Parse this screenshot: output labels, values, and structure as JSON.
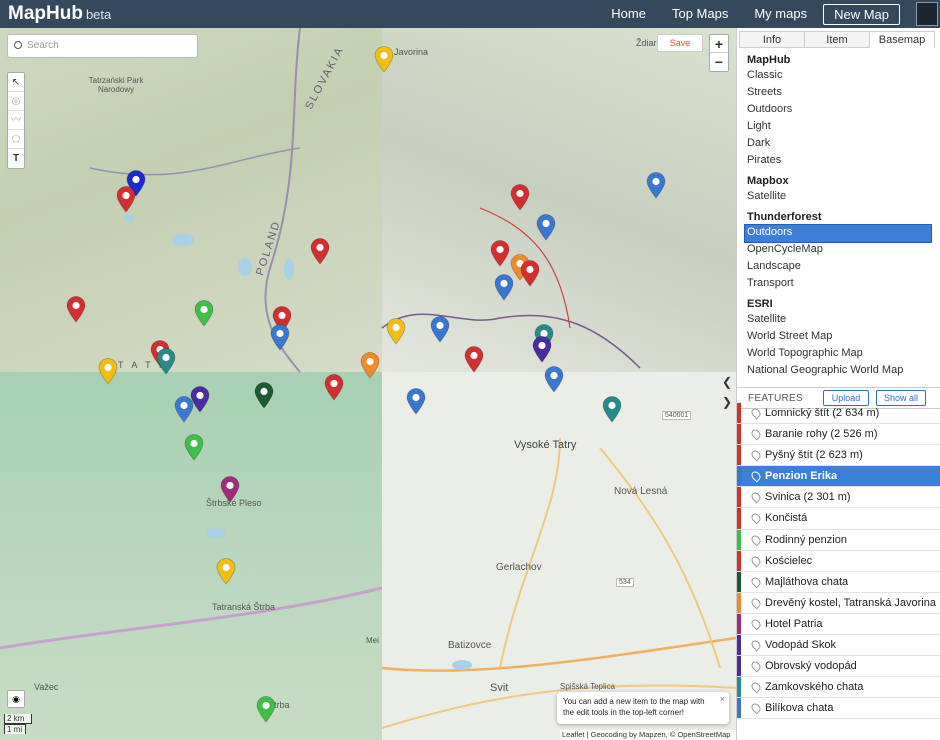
{
  "app": {
    "name": "MapHub",
    "tag": "beta"
  },
  "nav": {
    "home": "Home",
    "top_maps": "Top Maps",
    "my_maps": "My maps",
    "new_map": "New Map"
  },
  "map": {
    "search_placeholder": "Search",
    "save": "Save",
    "zoom_in": "+",
    "zoom_out": "−",
    "tools": [
      "↖",
      "◎",
      "〰",
      "⬠",
      "T"
    ],
    "scale_km": "2 km",
    "scale_mi": "1 mi",
    "tip": "You can add a new item to the map with the edit tools in the top-left corner!",
    "tip_close": "×",
    "attribution": "Leaflet | Geocoding by Mapzen, © OpenStreetMap",
    "labels": {
      "tatra_park": "Tatrzański Park Narodowy",
      "slovakia": "SLOVAKIA",
      "poland": "POLAND",
      "javorina": "Javorina",
      "zdiar": "Ždiar",
      "vysoke_tatry": "Vysoké Tatry",
      "nova_lesna": "Nová Lesná",
      "gerlachov": "Gerlachov",
      "batizovce": "Batizovce",
      "svit": "Svit",
      "strbske_pleso": "Štrbské Pleso",
      "tatranska_strba": "Tatranská Štrba",
      "vazec": "Važec",
      "spisska_teplica": "Spišská Teplica",
      "tatra": "T A T R",
      "road_540": "540001",
      "road_534": "534",
      "mei": "Mei",
      "strba": "Štrba"
    },
    "pin_colors": {
      "red": "#d32f2f",
      "blue": "#3a78d0",
      "navy": "#1a2ad0",
      "green": "#3fbf4a",
      "yellow": "#f2bd16",
      "orange": "#f08a2a",
      "teal": "#2a8a8a",
      "purple": "#4b2ca0",
      "darkgreen": "#1d5a33",
      "magenta": "#a12c7b"
    }
  },
  "panel": {
    "tabs": [
      "Info",
      "Item",
      "Basemap"
    ],
    "active_tab": "Basemap",
    "basemap_groups": [
      {
        "name": "MapHub",
        "items": [
          "Classic",
          "Streets",
          "Outdoors",
          "Light",
          "Dark",
          "Pirates"
        ]
      },
      {
        "name": "Mapbox",
        "items": [
          "Satellite"
        ]
      },
      {
        "name": "Thunderforest",
        "items": [
          "Outdoors",
          "OpenCycleMap",
          "Landscape",
          "Transport"
        ]
      },
      {
        "name": "ESRI",
        "items": [
          "Satellite",
          "World Street Map",
          "World Topographic Map",
          "National Geographic World Map"
        ]
      }
    ],
    "selected_basemap": "Thunderforest / Outdoors",
    "collapse_left": "❮",
    "collapse_right": "❯",
    "features_title": "FEATURES",
    "upload": "Upload",
    "show_all": "Show all",
    "features": [
      {
        "name": "Lomnický štít (2 634 m)",
        "color": "#d32f2f"
      },
      {
        "name": "Baranie rohy (2 526 m)",
        "color": "#d32f2f"
      },
      {
        "name": "Pyšný štít (2 623 m)",
        "color": "#d32f2f"
      },
      {
        "name": "Penzion Erika",
        "color": "#3a78d0",
        "selected": true
      },
      {
        "name": "Svinica (2 301 m)",
        "color": "#d32f2f"
      },
      {
        "name": "Končistá",
        "color": "#d32f2f"
      },
      {
        "name": "Rodinný penzion",
        "color": "#3fbf4a"
      },
      {
        "name": "Kościelec",
        "color": "#d32f2f"
      },
      {
        "name": "Majláthova chata",
        "color": "#1d5a33"
      },
      {
        "name": "Drevěný kostel, Tatranská Javorina",
        "color": "#f08a2a"
      },
      {
        "name": "Hotel Patria",
        "color": "#a12c7b"
      },
      {
        "name": "Vodopád Skok",
        "color": "#4b2ca0"
      },
      {
        "name": "Obrovský vodopád",
        "color": "#4b2ca0"
      },
      {
        "name": "Zamkovského chata",
        "color": "#2a8a8a"
      },
      {
        "name": "Bilíkova chata",
        "color": "#3a78d0"
      }
    ]
  }
}
